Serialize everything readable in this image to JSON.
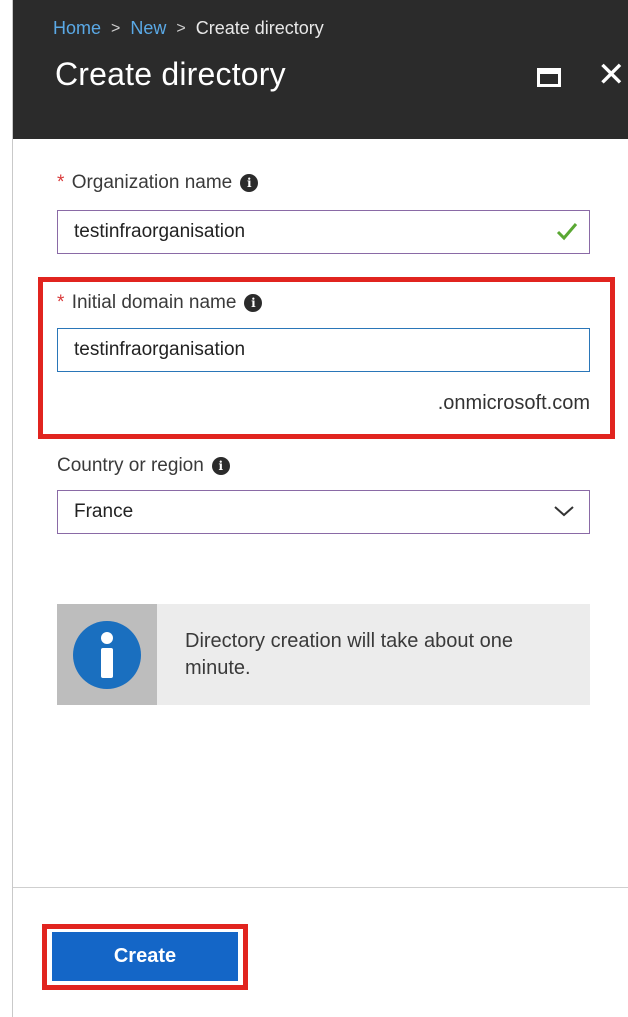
{
  "breadcrumb": {
    "items": [
      "Home",
      "New",
      "Create directory"
    ],
    "separator": ">"
  },
  "header": {
    "title": "Create directory",
    "maximize_icon": "maximize-icon",
    "close_glyph": "✕"
  },
  "form": {
    "org_name": {
      "label": "Organization name",
      "required": "*",
      "value": "testinfraorganisation",
      "valid_icon": "check-icon"
    },
    "domain_name": {
      "label": "Initial domain name",
      "required": "*",
      "value": "testinfraorganisation",
      "suffix": ".onmicrosoft.com"
    },
    "country": {
      "label": "Country or region",
      "value": "France"
    }
  },
  "banner": {
    "text": "Directory creation will take about one minute.",
    "icon": "info-icon"
  },
  "footer": {
    "create_label": "Create"
  },
  "colors": {
    "header_bg": "#2b2b2b",
    "link": "#5aa9e6",
    "primary_button": "#1466c7",
    "highlight": "#e1241f",
    "required": "#d93a3a",
    "valid": "#5aa833"
  }
}
